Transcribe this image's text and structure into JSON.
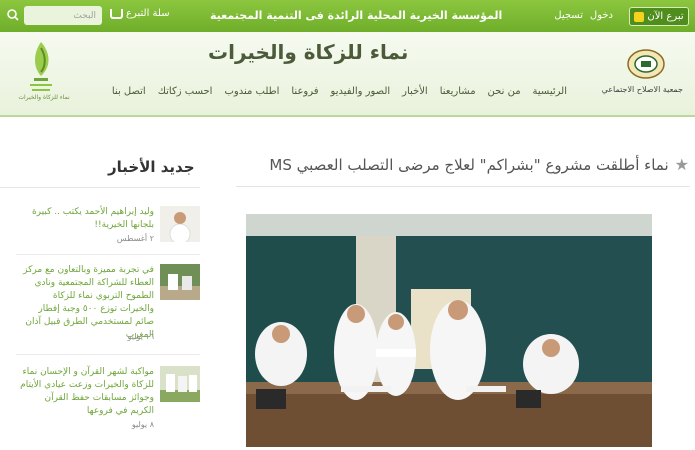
{
  "topbar": {
    "donate_now": "تبرع الآن",
    "login": "دخول",
    "register": "تسجيل",
    "tagline": "المؤسسة الخيرية المحلية الرائدة فى التنمية المجتمعية",
    "cart": "سلة التبرع",
    "search_placeholder": "البحث"
  },
  "header": {
    "site_title": "نماء للزكاة والخيرات",
    "partner_name": "جمعية الاصلاح الاجتماعي",
    "logo_caption": "نماء للزكاة والخيرات"
  },
  "nav": [
    "الرئيسية",
    "من نحن",
    "مشاريعنا",
    "الأخبار",
    "الصور والفيديو",
    "فروعنا",
    "اطلب مندوب",
    "احسب زكاتك",
    "اتصل بنا"
  ],
  "article": {
    "title": "نماء أطلقت مشروع \"بشراكم\" لعلاج مرضى التصلب العصبي MS"
  },
  "sidebar": {
    "heading": "جديد الأخبار",
    "items": [
      {
        "text": "وليد إبراهيم الأحمد يكتب .. كبيرة بلجانها الخيرية!!",
        "date": "٢ أغسطس"
      },
      {
        "text": "في تجربة مميزة وبالتعاون مع مركز العطاء للشراكة المجتمعية ونادي الطموح التربوي نماء للزكاة والخيرات توزع ٥٠٠ وجبة إفطار صائم لمستخدمي الطرق قبيل آذان المغرب",
        "date": "١٦ يوليو"
      },
      {
        "text": "مواكبة لشهر القرآن و الإحسان نماء للزكاة والخيرات وزعت عيادي الأيتام وجوائز مسابقات حفظ القرآن الكريم في فروعها",
        "date": "٨ يوليو"
      }
    ]
  },
  "colors": {
    "brand_green": "#7ab936",
    "link_green": "#6fa63a"
  }
}
